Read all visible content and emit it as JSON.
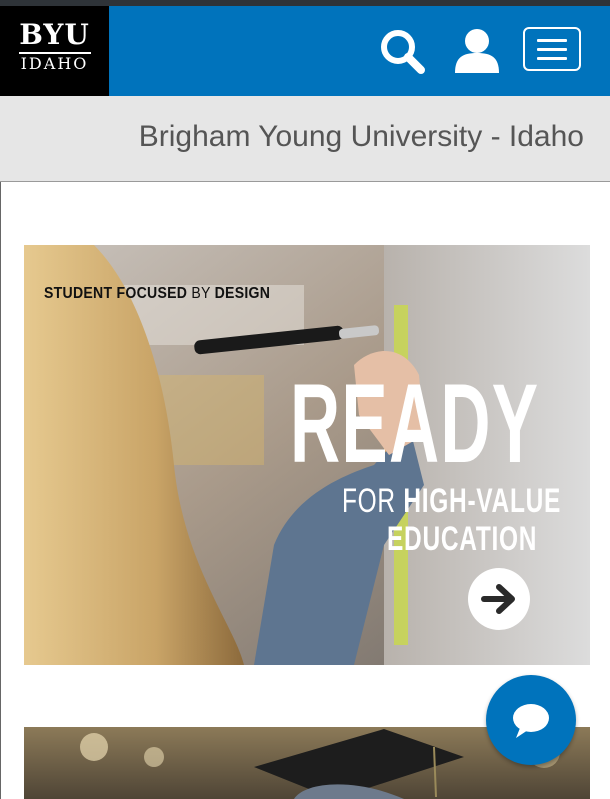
{
  "header": {
    "logo_line1": "BYU",
    "logo_line2": "IDAHO",
    "icons": [
      "search-icon",
      "user-icon",
      "hamburger-menu-icon"
    ],
    "accent_color": "#0073bc"
  },
  "title_bar": {
    "title": "Brigham Young University - Idaho"
  },
  "hero_banner": {
    "tagline_bold1": "STUDENT FOCUSED",
    "tagline_light": " BY ",
    "tagline_bold2": "DESIGN",
    "headline": "READY",
    "sub_line1_light": "FOR ",
    "sub_line1_bold": "HIGH-VALUE",
    "sub_line2": "EDUCATION",
    "cta_icon": "arrow-right-icon"
  },
  "chat": {
    "icon": "chat-bubble-icon"
  }
}
